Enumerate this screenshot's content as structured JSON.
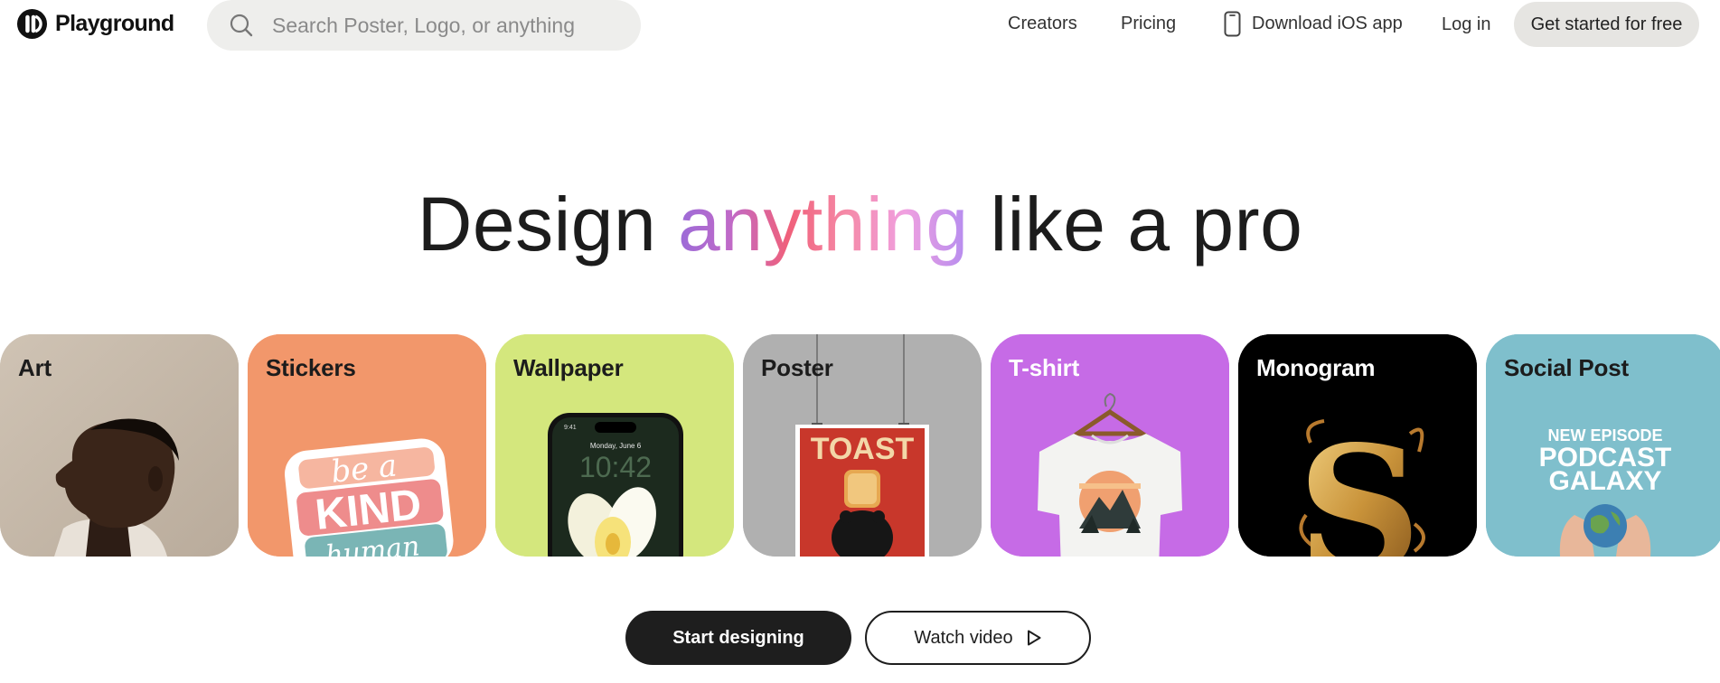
{
  "brand": {
    "name": "Playground",
    "logo_icon": "playground-logo-icon"
  },
  "search": {
    "placeholder": "Search Poster, Logo, or anything",
    "icon": "search-icon"
  },
  "nav": {
    "creators": "Creators",
    "pricing": "Pricing",
    "download_ios": "Download iOS app",
    "download_icon": "phone-icon",
    "login": "Log in",
    "cta": "Get started for free"
  },
  "hero": {
    "before": "Design",
    "accent": "anything",
    "after": "like a pro"
  },
  "categories": [
    {
      "label": "Art",
      "bg": "#c9bcae"
    },
    {
      "label": "Stickers",
      "bg": "#f2976b"
    },
    {
      "label": "Wallpaper",
      "bg": "#d4e77d"
    },
    {
      "label": "Poster",
      "bg": "#b0b0b0"
    },
    {
      "label": "T-shirt",
      "bg": "#c66be6"
    },
    {
      "label": "Monogram",
      "bg": "#000000"
    },
    {
      "label": "Social Post",
      "bg": "#7fbfcc"
    }
  ],
  "card_art": {
    "sticker_line1": "be a",
    "sticker_line2": "KIND",
    "sticker_line3": "human",
    "wallpaper_date": "Monday, June 6",
    "wallpaper_time": "10:42",
    "wallpaper_status_time": "9:41",
    "poster_title": "TOAST",
    "monogram_letter": "S",
    "social_line1": "NEW EPISODE",
    "social_line2": "PODCAST",
    "social_line3": "GALAXY"
  },
  "actions": {
    "start": "Start designing",
    "watch": "Watch video",
    "watch_icon": "play-icon"
  },
  "colors": {
    "cta_dark": "#1e1e1e",
    "search_bg": "#eeeeec",
    "gradient": [
      "#9b6bd8",
      "#f0607a",
      "#f58aa8",
      "#b48cf0"
    ]
  }
}
